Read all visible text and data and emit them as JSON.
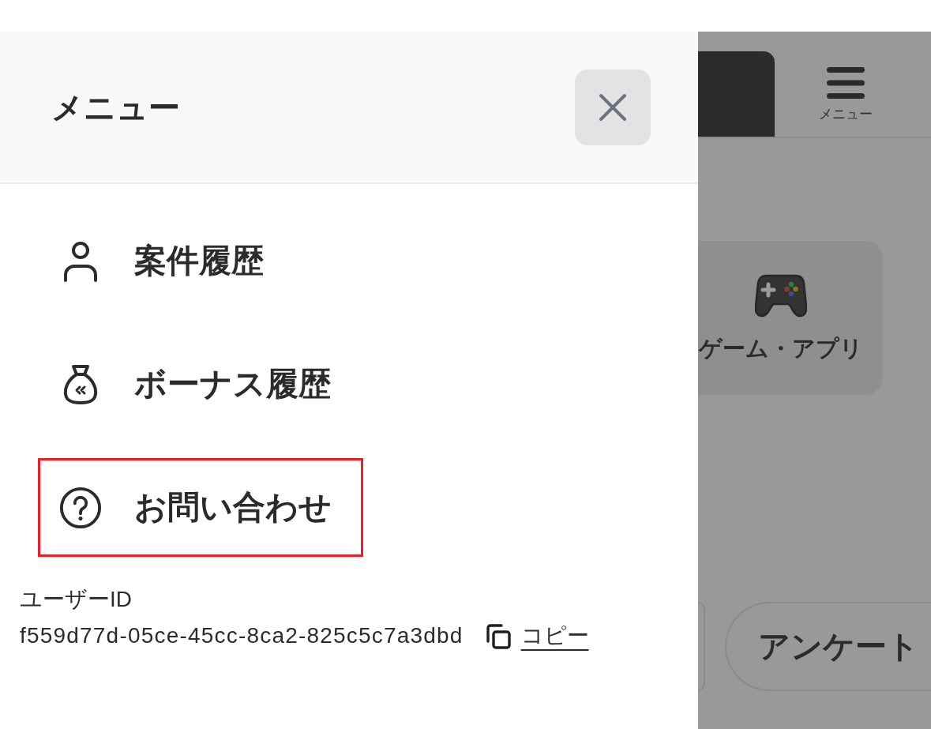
{
  "drawer": {
    "title": "メニュー",
    "menu_items": [
      {
        "label": "案件履歴",
        "highlighted": false
      },
      {
        "label": "ボーナス履歴",
        "highlighted": false
      },
      {
        "label": "お問い合わせ",
        "highlighted": true
      }
    ],
    "user_id": {
      "label": "ユーザーID",
      "value": "f559d77d-05ce-45cc-8ca2-825c5c7a3dbd",
      "copy_link": "コピー"
    }
  },
  "background_page": {
    "menu_button_label": "メニュー",
    "category_card": {
      "label": "ゲーム・アプリ"
    },
    "pill_buttons": [
      {
        "label": "アンケート"
      }
    ]
  }
}
